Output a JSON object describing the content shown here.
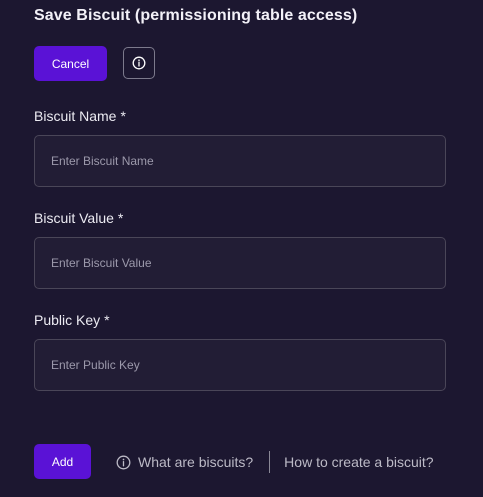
{
  "header": {
    "title": "Save Biscuit (permissioning table access)"
  },
  "actions": {
    "cancel_label": "Cancel",
    "info_icon": "info-icon"
  },
  "form": {
    "fields": [
      {
        "label": "Biscuit Name",
        "required_mark": "*",
        "placeholder": "Enter Biscuit Name",
        "value": ""
      },
      {
        "label": "Biscuit Value",
        "required_mark": "*",
        "placeholder": "Enter Biscuit Value",
        "value": ""
      },
      {
        "label": "Public Key",
        "required_mark": "*",
        "placeholder": "Enter Public Key",
        "value": ""
      }
    ],
    "add_label": "Add"
  },
  "footer": {
    "what_label": "What are biscuits?",
    "what_icon": "info-icon",
    "how_label": "How to create a biscuit?"
  },
  "colors": {
    "background": "#1c1730",
    "primary": "#5a12d6",
    "input_background": "#221d35",
    "input_border": "#4a4658"
  }
}
